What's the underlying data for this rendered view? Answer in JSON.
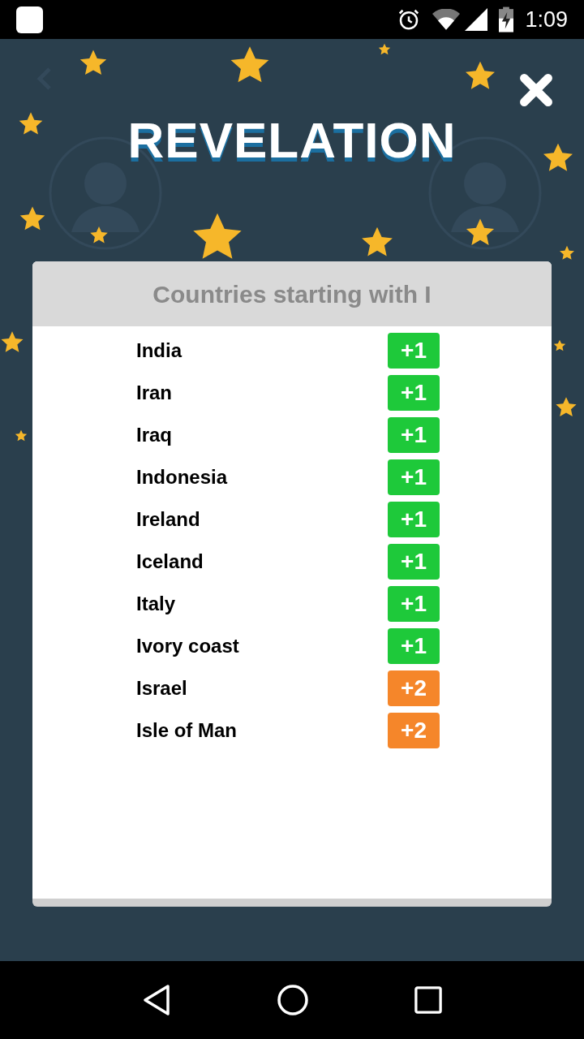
{
  "status_bar": {
    "time": "1:09"
  },
  "overlay": {
    "title": "REVELATION"
  },
  "dialog": {
    "title": "Countries starting with I",
    "answers": [
      {
        "name": "India",
        "points": "+1",
        "color": "#1ec93a"
      },
      {
        "name": "Iran",
        "points": "+1",
        "color": "#1ec93a"
      },
      {
        "name": "Iraq",
        "points": "+1",
        "color": "#1ec93a"
      },
      {
        "name": "Indonesia",
        "points": "+1",
        "color": "#1ec93a"
      },
      {
        "name": "Ireland",
        "points": "+1",
        "color": "#1ec93a"
      },
      {
        "name": "Iceland",
        "points": "+1",
        "color": "#1ec93a"
      },
      {
        "name": "Italy",
        "points": "+1",
        "color": "#1ec93a"
      },
      {
        "name": "Ivory coast",
        "points": "+1",
        "color": "#1ec93a"
      },
      {
        "name": "Israel",
        "points": "+2",
        "color": "#f5862a"
      },
      {
        "name": "Isle of Man",
        "points": "+2",
        "color": "#f5862a"
      }
    ]
  }
}
